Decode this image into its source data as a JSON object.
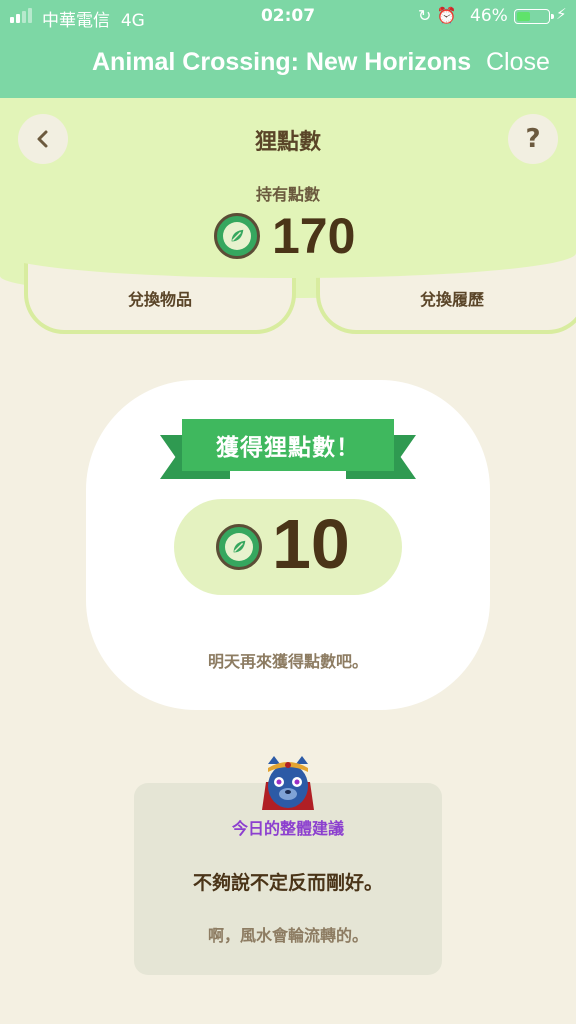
{
  "status_bar": {
    "carrier": "中華電信",
    "network": "4G",
    "time": "02:07",
    "battery_percent": "46%",
    "battery_level": 0.46,
    "colors": {
      "battery_fill": "#5fe36b"
    }
  },
  "header": {
    "title": "Animal Crossing: New Horizons",
    "close_label": "Close",
    "background": "#7dd7a5"
  },
  "points_page": {
    "title": "狸點數",
    "back_icon": "chevron-left-icon",
    "help_label": "?",
    "owned_label": "持有點數",
    "owned_value": "170",
    "coin_icon": "leaf-coin-icon"
  },
  "tabs": [
    {
      "label": "兌換物品"
    },
    {
      "label": "兌換履歷"
    }
  ],
  "reward": {
    "banner": "獲得狸點數！",
    "value": "10",
    "note": "明天再來獲得點數吧。"
  },
  "fortune": {
    "avatar_icon": "fortune-teller-avatar",
    "title": "今日的整體建議",
    "main": "不夠說不定反而剛好。",
    "sub": "啊，風水會輪流轉的。"
  }
}
